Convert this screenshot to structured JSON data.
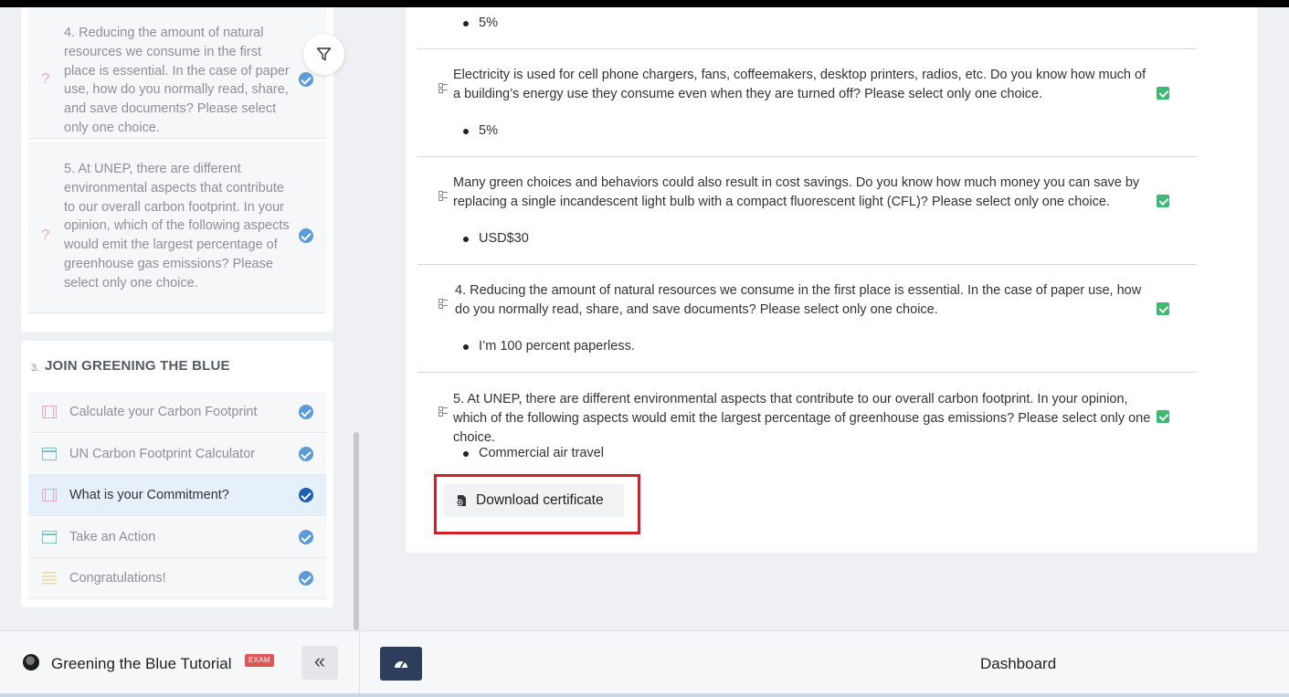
{
  "sidebar": {
    "top_questions": [
      {
        "text": "4. Reducing the amount of natural resources we consume in the first place is essential. In the case of paper use, how do you normally read, share, and save documents? Please select only one choice.",
        "icon": "question-icon"
      },
      {
        "text": "5. At UNEP, there are different environmental aspects that contribute to our overall carbon footprint. In your opinion, which of the following aspects would emit the largest percentage of greenhouse gas emissions? Please select only one choice.",
        "icon": "question-icon"
      }
    ],
    "section": {
      "number": "3.",
      "title": "JOIN GREENING THE BLUE",
      "lessons": [
        {
          "label": "Calculate your Carbon Footprint",
          "icon": "video-icon"
        },
        {
          "label": "UN Carbon Footprint Calculator",
          "icon": "web-page-icon"
        },
        {
          "label": "What is your Commitment?",
          "icon": "video-icon",
          "active": true
        },
        {
          "label": "Take an Action",
          "icon": "web-page-icon"
        },
        {
          "label": "Congratulations!",
          "icon": "text-icon"
        }
      ]
    },
    "filter_icon": "filter-icon"
  },
  "footer_left": {
    "course_title": "Greening the Blue Tutorial",
    "badge": "EXAM",
    "collapse_label": "«"
  },
  "main": {
    "top_answer": "5%",
    "qa": [
      {
        "question": "Electricity is used for cell phone chargers, fans, coffeemakers, desktop printers, radios, etc. Do you know how much of a building’s energy use they consume even when they are turned off? Please select only one choice.",
        "answer": "5%"
      },
      {
        "question": "Many green choices and behaviors could also result in cost savings. Do you know how much money you can save by replacing a single incandescent light bulb with a compact fluorescent light (CFL)? Please select only one choice.",
        "answer": "USD$30"
      },
      {
        "question": "4. Reducing the amount of natural resources we consume in the first place is essential. In the case of paper use, how do you normally read, share, and save documents? Please select only one choice.",
        "answer": "I’m 100 percent paperless."
      },
      {
        "question": "5. At UNEP, there are different environmental aspects that contribute to our overall carbon footprint. In your opinion, which of the following aspects would emit the largest percentage of greenhouse gas emissions? Please select only one choice.",
        "answer": "Commercial air travel"
      }
    ],
    "download_label": "Download certificate"
  },
  "footer_right": {
    "dashboard_label": "Dashboard"
  },
  "colors": {
    "check_blue": "#5b9bd9",
    "check_green": "#3fb871",
    "highlight_red": "#d0202a",
    "dashboard_button": "#2d3e5c"
  }
}
